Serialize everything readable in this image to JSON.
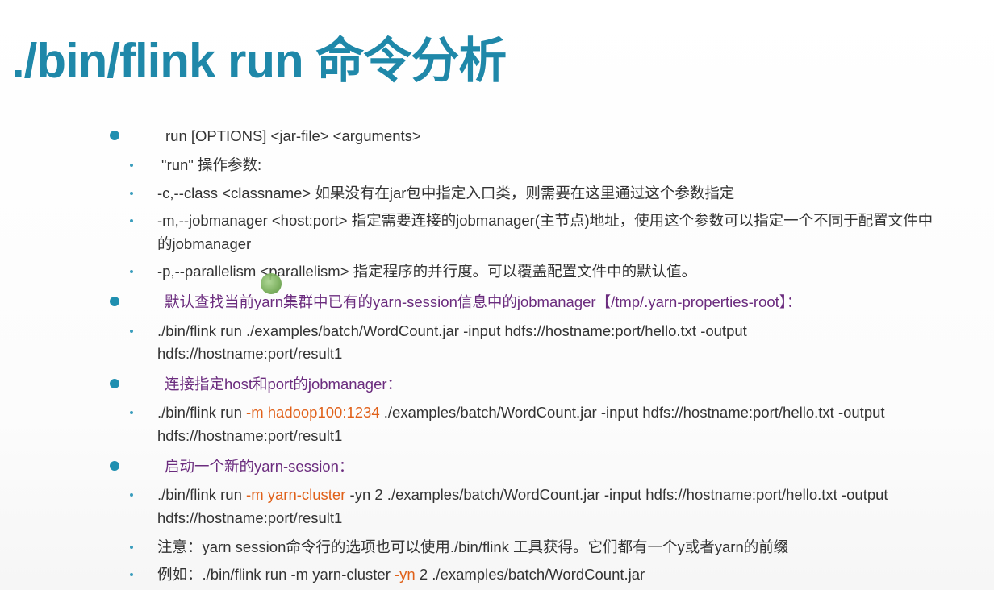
{
  "title": "./bin/flink run 命令分析",
  "items": [
    {
      "text": "run [OPTIONS] <jar-file> <arguments>"
    },
    {
      "text": "\"run\" 操作参数:"
    },
    {
      "text": "-c,--class <classname>  如果没有在jar包中指定入口类，则需要在这里通过这个参数指定"
    },
    {
      "line1": "-m,--jobmanager <host:port>  指定需要连接的jobmanager(主节点)地址，使用这个参数可以指定一个不同于配置文件中",
      "line2": "的jobmanager"
    },
    {
      "text": "-p,--parallelism <parallelism>   指定程序的并行度。可以覆盖配置文件中的默认值。"
    },
    {
      "text": "默认查找当前yarn集群中已有的yarn-session信息中的jobmanager【/tmp/.yarn-properties-root】："
    },
    {
      "line1": "./bin/flink run ./examples/batch/WordCount.jar -input hdfs://hostname:port/hello.txt -output",
      "line2": "hdfs://hostname:port/result1"
    },
    {
      "text": "连接指定host和port的jobmanager："
    },
    {
      "prefix": "./bin/flink run ",
      "highlight": "-m hadoop100:1234",
      "suffix": " ./examples/batch/WordCount.jar -input hdfs://hostname:port/hello.txt -output",
      "line2": "hdfs://hostname:port/result1"
    },
    {
      "text": "启动一个新的yarn-session："
    },
    {
      "prefix": "./bin/flink run ",
      "highlight": "-m yarn-cluster",
      "suffix": " -yn 2 ./examples/batch/WordCount.jar -input hdfs://hostname:port/hello.txt -output",
      "line2": "hdfs://hostname:port/result1"
    },
    {
      "text": "注意：yarn session命令行的选项也可以使用./bin/flink 工具获得。它们都有一个y或者yarn的前缀"
    },
    {
      "prefix": "例如：./bin/flink run -m yarn-cluster ",
      "highlight": "-yn",
      "suffix": " 2 ./examples/batch/WordCount.jar"
    }
  ]
}
